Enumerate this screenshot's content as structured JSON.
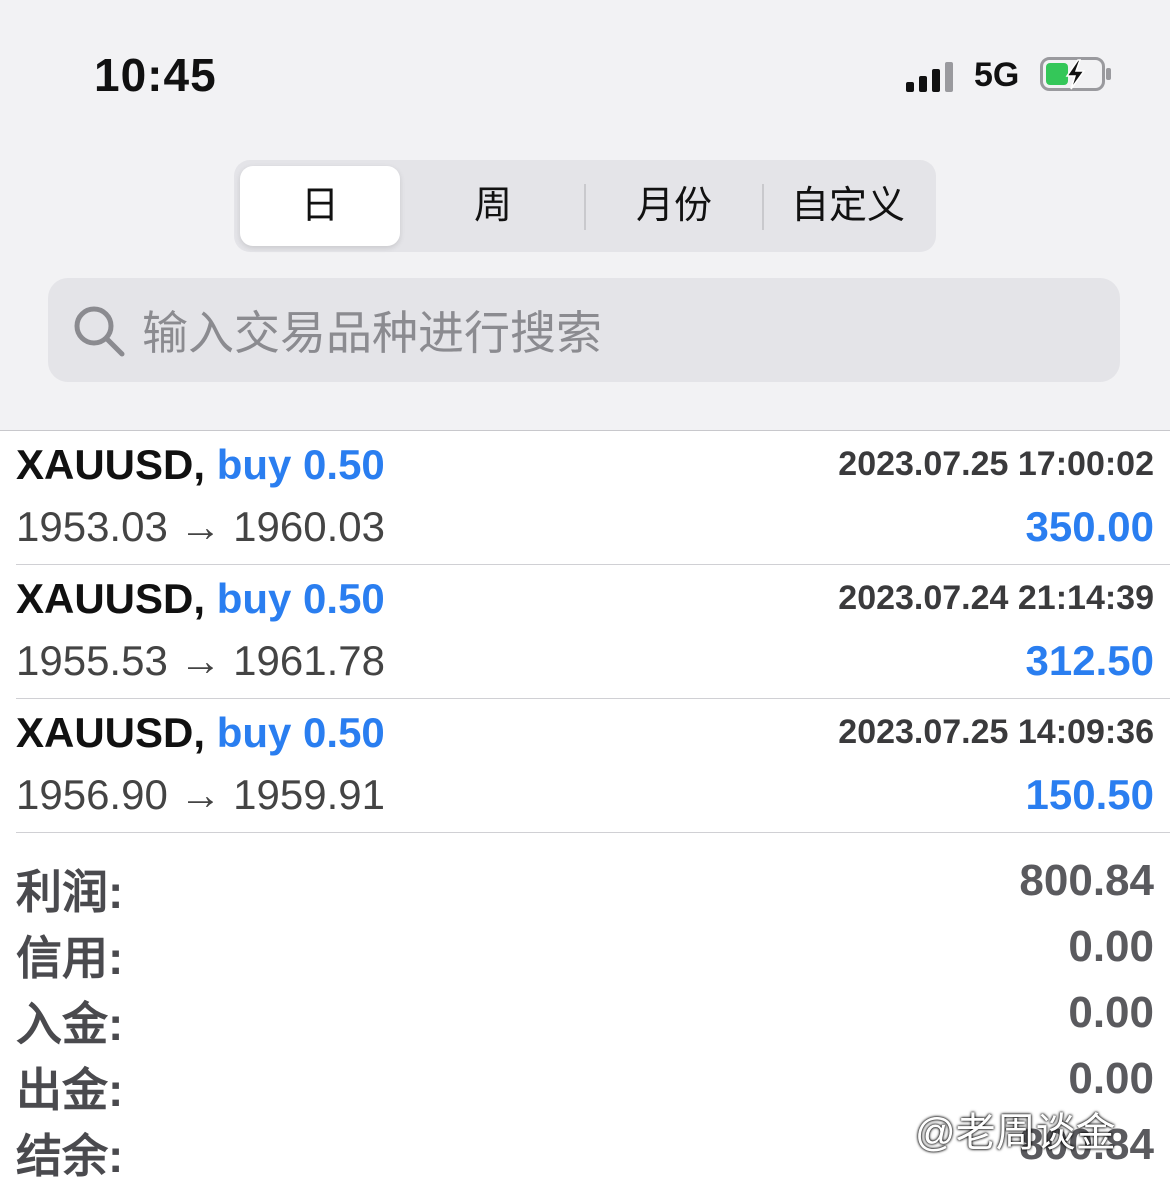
{
  "status_bar": {
    "time": "10:45",
    "network": "5G",
    "battery_color": "#34c759"
  },
  "period_tabs": [
    {
      "label": "日",
      "active": true
    },
    {
      "label": "周",
      "active": false
    },
    {
      "label": "月份",
      "active": false
    },
    {
      "label": "自定义",
      "active": false
    }
  ],
  "search": {
    "placeholder": "输入交易品种进行搜索",
    "icon": "search-icon"
  },
  "trades": [
    {
      "symbol": "XAUUSD,",
      "side": "buy 0.50",
      "time": "2023.07.25 17:00:02",
      "prices": "1953.03 → 1960.03",
      "profit": "350.00"
    },
    {
      "symbol": "XAUUSD,",
      "side": "buy 0.50",
      "time": "2023.07.24 21:14:39",
      "prices": "1955.53 → 1961.78",
      "profit": "312.50"
    },
    {
      "symbol": "XAUUSD,",
      "side": "buy 0.50",
      "time": "2023.07.25 14:09:36",
      "prices": "1956.90 → 1959.91",
      "profit": "150.50"
    }
  ],
  "summary": [
    {
      "label": "利润:",
      "value": "800.84"
    },
    {
      "label": "信用:",
      "value": "0.00"
    },
    {
      "label": "入金:",
      "value": "0.00"
    },
    {
      "label": "出金:",
      "value": "0.00"
    },
    {
      "label": "结余:",
      "value": "800.84"
    }
  ],
  "watermark": "@老周谈金",
  "colors": {
    "accent_blue": "#2a7ef0",
    "background_gray": "#f2f2f4"
  }
}
